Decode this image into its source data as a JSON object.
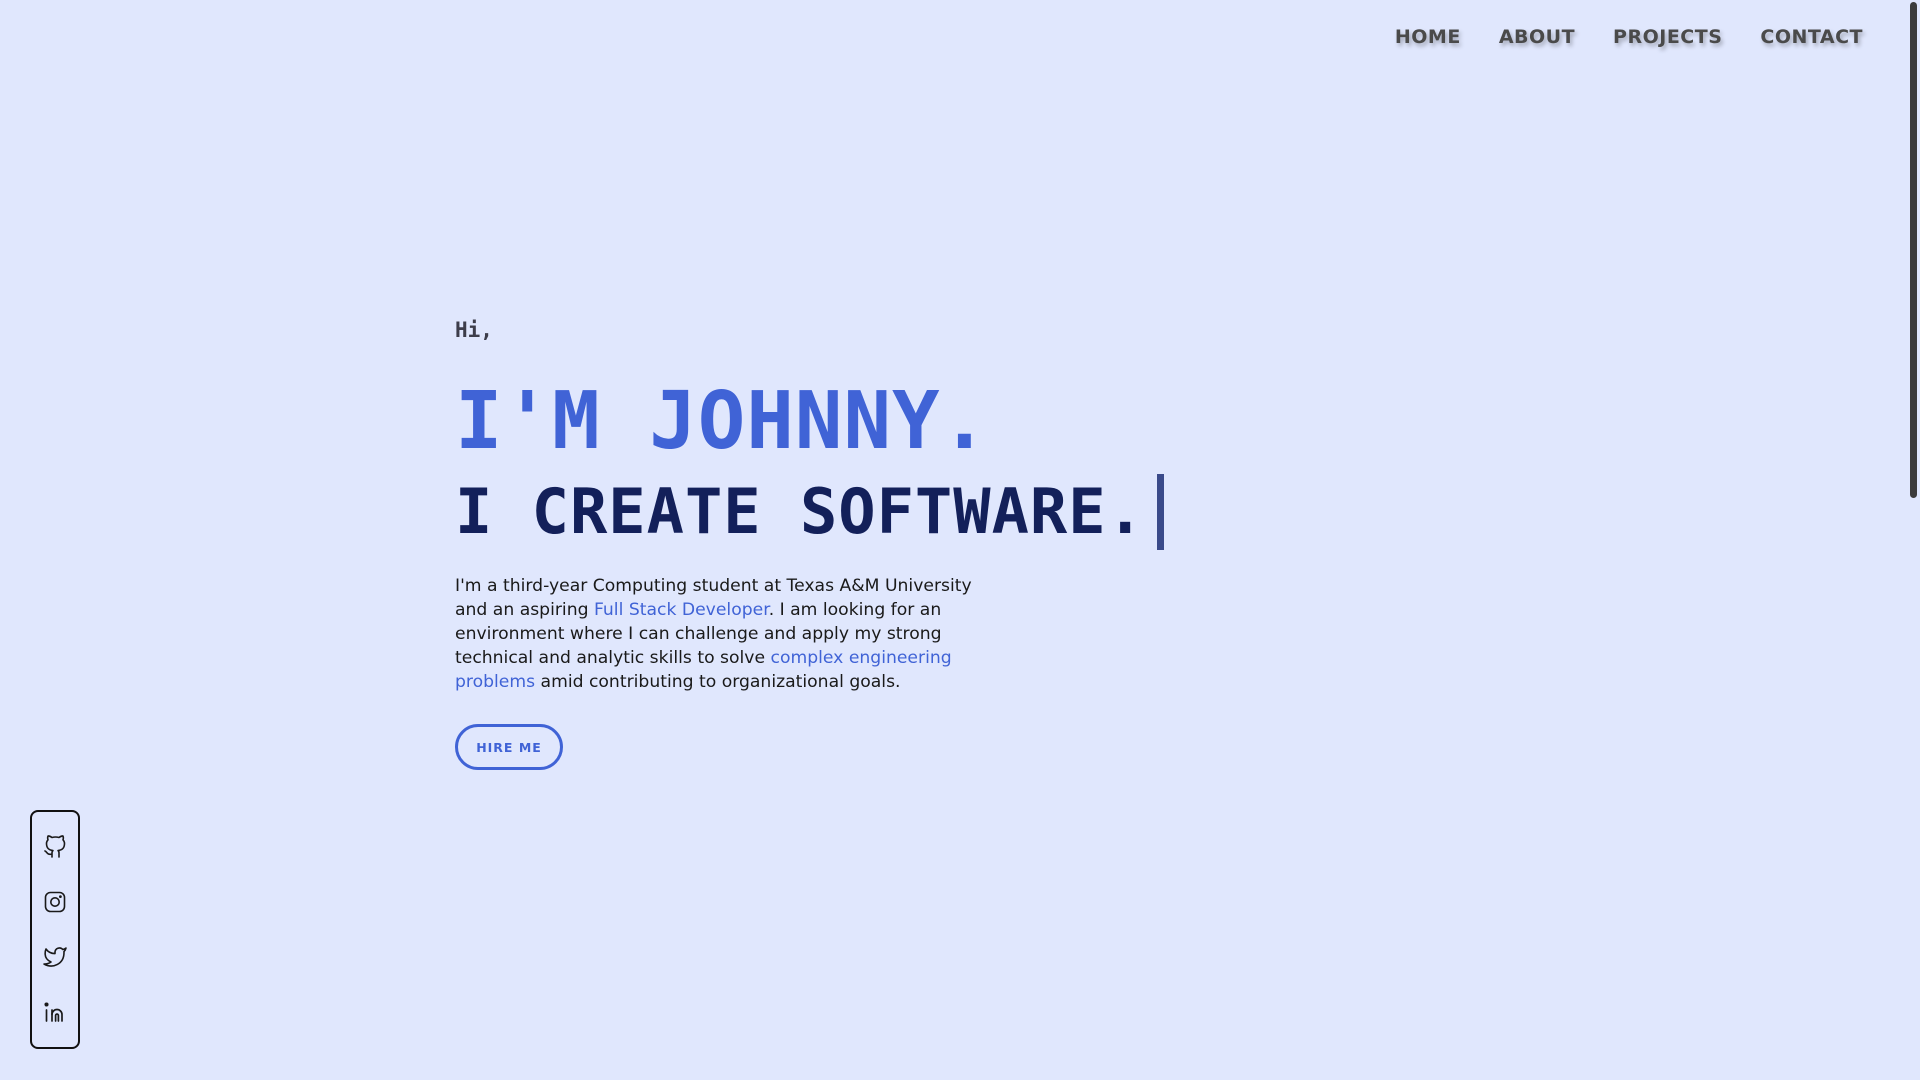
{
  "nav": {
    "items": [
      {
        "label": "HOME"
      },
      {
        "label": "ABOUT"
      },
      {
        "label": "PROJECTS"
      },
      {
        "label": "CONTACT"
      }
    ]
  },
  "hero": {
    "greeting": "Hi,",
    "name": "I'M JOHNNY.",
    "tagline": "I CREATE SOFTWARE.",
    "description": {
      "part1": "I'm a third-year Computing student at Texas A&M University and an aspiring ",
      "highlight1": "Full Stack Developer",
      "part2": ". I am looking for an environment where I can challenge and apply my strong technical and analytic skills to solve ",
      "highlight2": "complex engineering problems",
      "part3": " amid contributing to organizational goals."
    },
    "cta_label": "HIRE ME"
  },
  "social": {
    "icons": [
      "github-icon",
      "instagram-icon",
      "twitter-icon",
      "linkedin-icon"
    ]
  },
  "colors": {
    "background": "#e0e7fd",
    "accent": "#4063d6",
    "heading_dark": "#13205a",
    "nav_text": "#4a4a4a"
  }
}
